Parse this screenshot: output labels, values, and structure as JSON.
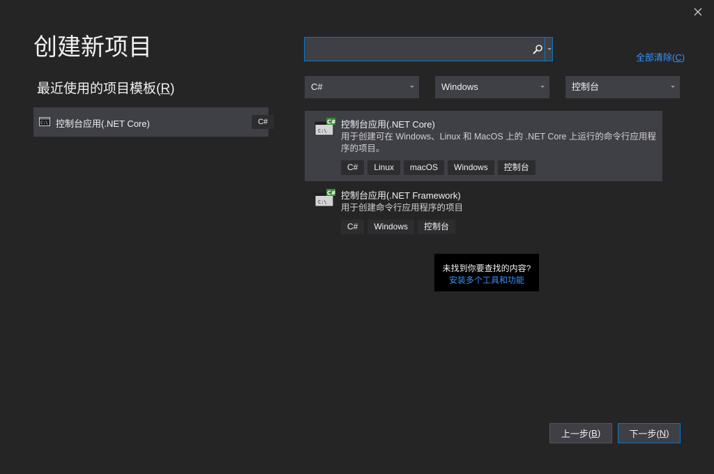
{
  "dialog": {
    "title": "创建新项目",
    "close_icon": "close-icon"
  },
  "recent": {
    "heading": "最近使用的项目模板(",
    "heading_key": "R",
    "heading_end": ")",
    "items": [
      {
        "icon": "console-app-icon",
        "label": "控制台应用(.NET Core)",
        "tag": "C#"
      }
    ]
  },
  "search": {
    "value": "",
    "placeholder": "",
    "icon": "search-icon"
  },
  "clear_all": {
    "label": "全部清除(",
    "key": "C",
    "end": ")"
  },
  "filters": {
    "language": "C#",
    "platform": "Windows",
    "project_type": "控制台"
  },
  "templates": [
    {
      "title": "控制台应用(.NET Core)",
      "description": "用于创建可在 Windows、Linux 和 MacOS 上的 .NET Core 上运行的命令行应用程序的项目。",
      "tags": [
        "C#",
        "Linux",
        "macOS",
        "Windows",
        "控制台"
      ],
      "icon": "csharp-console-icon"
    },
    {
      "title": "控制台应用(.NET Framework)",
      "description": "用于创建命令行应用程序的项目",
      "tags": [
        "C#",
        "Windows",
        "控制台"
      ],
      "icon": "csharp-console-icon"
    }
  ],
  "not_found": {
    "question": "未找到你要查找的内容?",
    "link": "安装多个工具和功能"
  },
  "footer": {
    "back_label": "上一步(",
    "back_key": "B",
    "next_label": "下一步(",
    "next_key": "N",
    "close_paren": ")"
  },
  "colors": {
    "background": "#252526",
    "panel": "#3f3f46",
    "accent": "#007acc",
    "link": "#3794ff",
    "csharp_badge": "#388a34"
  }
}
